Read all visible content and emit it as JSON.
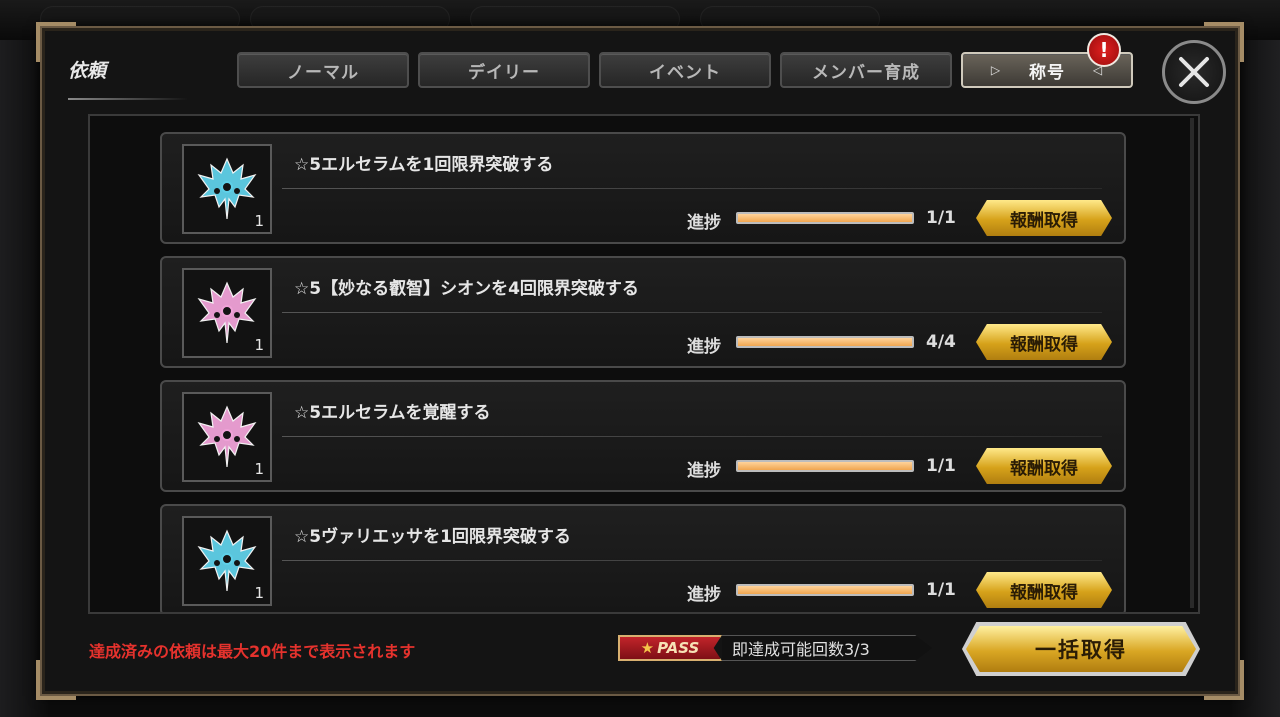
{
  "panel": {
    "title": "依頼"
  },
  "tabs": [
    {
      "label": "ノーマル",
      "active": false
    },
    {
      "label": "デイリー",
      "active": false
    },
    {
      "label": "イベント",
      "active": false
    },
    {
      "label": "メンバー育成",
      "active": false
    },
    {
      "label": "称号",
      "active": true
    }
  ],
  "notification_badge": "!",
  "close_icon": "close-icon",
  "quests": [
    {
      "title": "☆5エルセラムを1回限界突破する",
      "icon": "crest-icon",
      "icon_color": "#5fd0e8",
      "icon_count": "1",
      "progress_label": "進捗",
      "progress": 1.0,
      "count": "1/1",
      "reward_label": "報酬取得"
    },
    {
      "title": "☆5【妙なる叡智】シオンを4回限界突破する",
      "icon": "crest-icon",
      "icon_color": "#f0a2d8",
      "icon_count": "1",
      "progress_label": "進捗",
      "progress": 1.0,
      "count": "4/4",
      "reward_label": "報酬取得"
    },
    {
      "title": "☆5エルセラムを覚醒する",
      "icon": "crest-icon",
      "icon_color": "#f0a2d8",
      "icon_count": "1",
      "progress_label": "進捗",
      "progress": 1.0,
      "count": "1/1",
      "reward_label": "報酬取得"
    },
    {
      "title": "☆5ヴァリエッサを1回限界突破する",
      "icon": "crest-icon",
      "icon_color": "#5fd0e8",
      "icon_count": "1",
      "progress_label": "進捗",
      "progress": 1.0,
      "count": "1/1",
      "reward_label": "報酬取得"
    }
  ],
  "footer": {
    "note": "達成済みの依頼は最大20件まで表示されます",
    "pass_label": "PASS",
    "pass_count": "即達成可能回数3/3",
    "bulk_button": "一括取得"
  },
  "colors": {
    "accent_gold": "#d6a21a",
    "warning_red": "#e5322d",
    "progress_fill": "#f0a650"
  }
}
